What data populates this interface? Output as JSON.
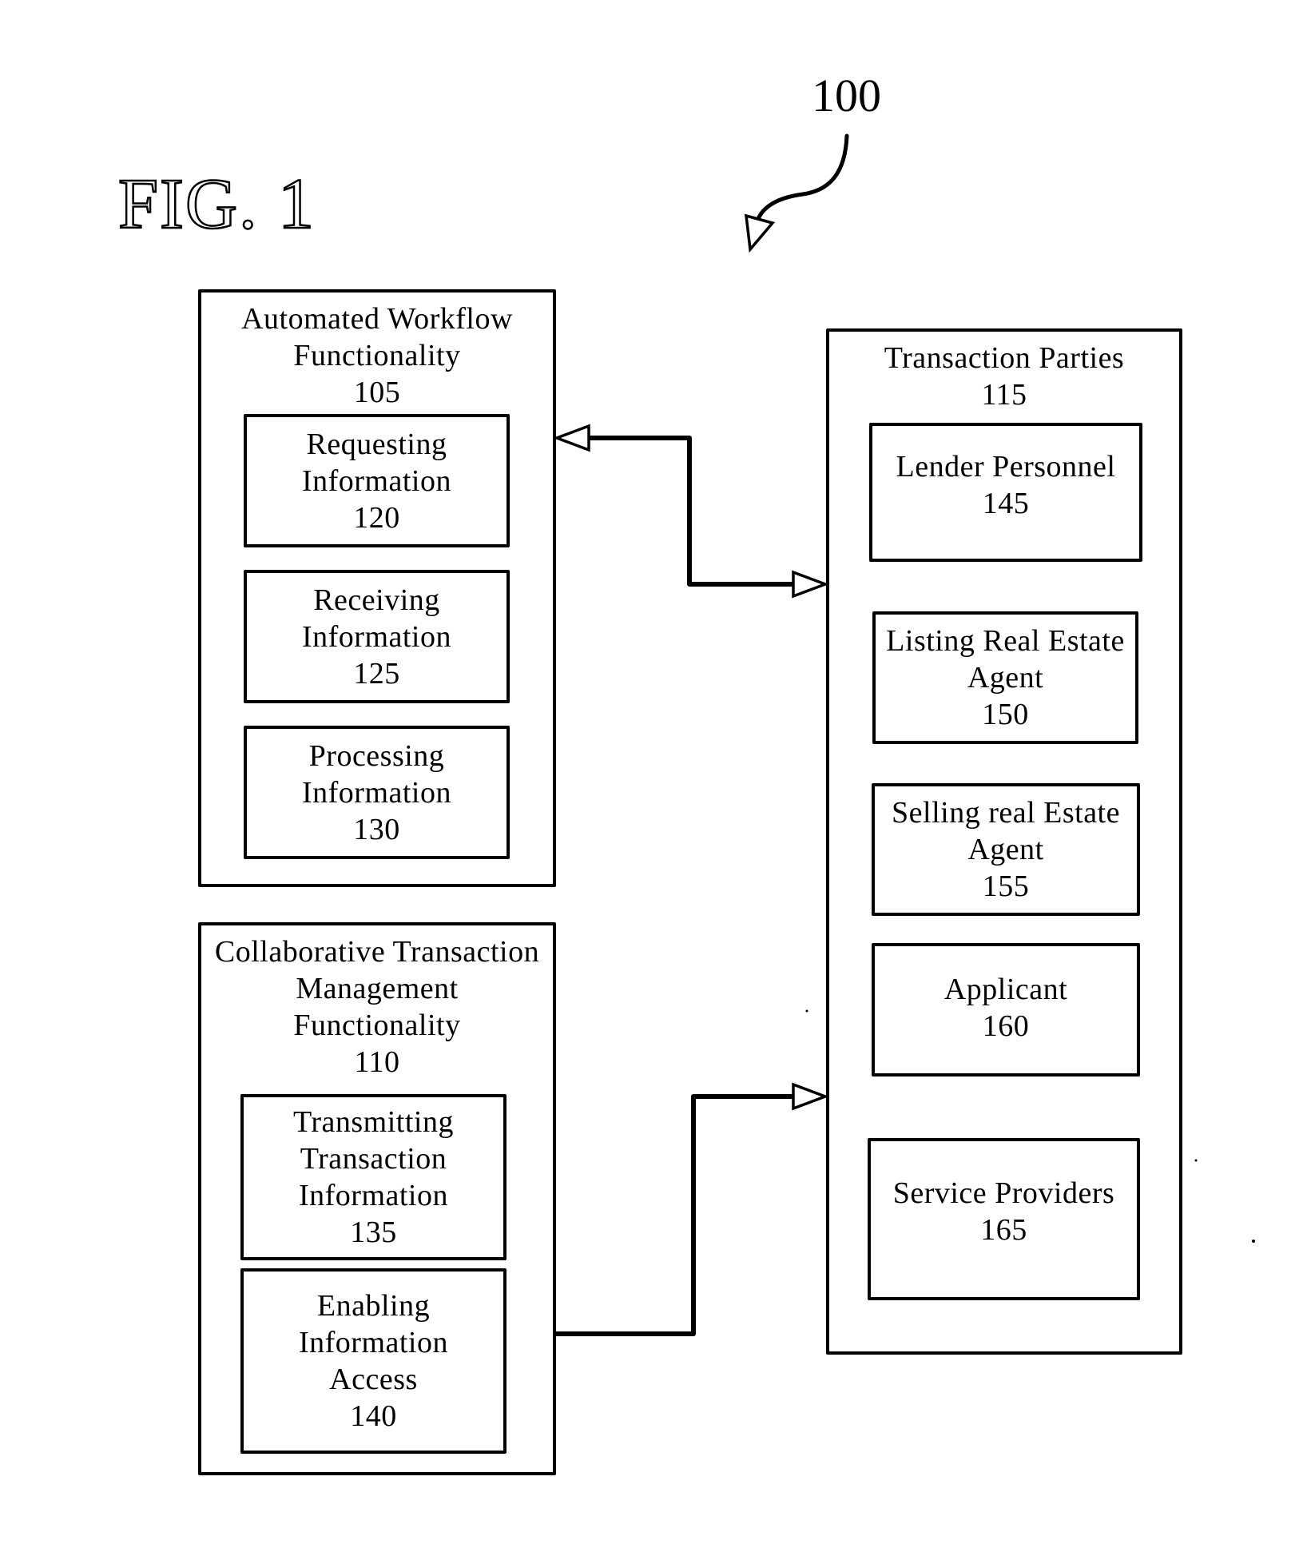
{
  "figure": {
    "label": "FIG. 1",
    "reference_number": "100"
  },
  "boxes": {
    "automated_workflow": {
      "lines": [
        "Automated Workflow",
        "Functionality",
        "105"
      ],
      "children": {
        "requesting": {
          "lines": [
            "Requesting",
            "Information",
            "120"
          ]
        },
        "receiving": {
          "lines": [
            "Receiving",
            "Information",
            "125"
          ]
        },
        "processing": {
          "lines": [
            "Processing",
            "Information",
            "130"
          ]
        }
      }
    },
    "collaborative": {
      "lines": [
        "Collaborative Transaction",
        "Management",
        "Functionality",
        "110"
      ],
      "children": {
        "transmitting": {
          "lines": [
            "Transmitting",
            "Transaction",
            "Information",
            "135"
          ]
        },
        "enabling": {
          "lines": [
            "Enabling",
            "Information",
            "Access",
            "140"
          ]
        }
      }
    },
    "transaction_parties": {
      "lines": [
        "Transaction Parties",
        "115"
      ],
      "children": {
        "lender": {
          "lines": [
            "Lender Personnel",
            "145"
          ]
        },
        "listing_agent": {
          "lines": [
            "Listing Real Estate",
            "Agent",
            "150"
          ]
        },
        "selling_agent": {
          "lines": [
            "Selling real Estate",
            "Agent",
            "155"
          ]
        },
        "applicant": {
          "lines": [
            "Applicant",
            "160"
          ]
        },
        "service_providers": {
          "lines": [
            "Service Providers",
            "165"
          ]
        }
      }
    }
  },
  "connections": [
    {
      "from": "automated_workflow",
      "to": "transaction_parties",
      "type": "bidirectional-arrow"
    },
    {
      "from": "collaborative",
      "to": "transaction_parties",
      "type": "one-way-arrow"
    }
  ],
  "colors": {
    "ink": "#000000",
    "paper": "#ffffff"
  }
}
